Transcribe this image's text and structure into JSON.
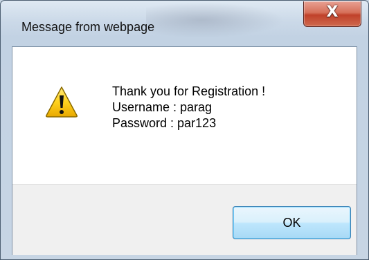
{
  "window": {
    "title": "Message from webpage",
    "close_glyph": "X"
  },
  "message": {
    "icon": "warning-icon",
    "lines": [
      "Thank you for Registration !",
      "Username : parag",
      "Password : par123"
    ]
  },
  "buttons": {
    "ok_label": "OK"
  },
  "colors": {
    "warning_yellow": "#f5c400",
    "close_red": "#c7432b",
    "button_blue": "#3c7fb1"
  }
}
